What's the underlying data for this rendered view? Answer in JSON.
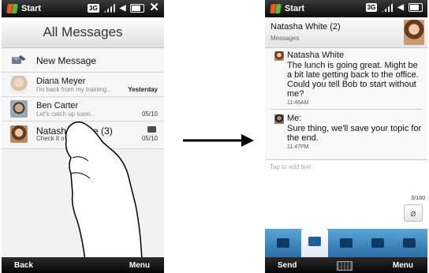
{
  "left_phone": {
    "status": {
      "start_label": "Start",
      "network": "3G",
      "close": "✕"
    },
    "header": {
      "title": "All Messages"
    },
    "new_message_label": "New Message",
    "messages": [
      {
        "name": "Diana Meyer",
        "preview": "I'm back from my training...",
        "date": "Yesterday"
      },
      {
        "name": "Ben Carter",
        "preview": "Let's catch up soon..",
        "date": "05/10"
      },
      {
        "name": "Natasha White (3)",
        "preview": "Check it o",
        "date": "05/10"
      }
    ],
    "softkeys": {
      "left": "Back",
      "right": "Menu"
    }
  },
  "right_phone": {
    "status": {
      "start_label": "Start",
      "network": "3G"
    },
    "conversation": {
      "title": "Natasha White (2)",
      "subtitle": "Messages"
    },
    "thread": [
      {
        "sender": "Natasha White",
        "text": "The lunch is going great. Might be a bit late getting back to the office. Could you tell Bob to start without me?",
        "time": "11:46AM"
      },
      {
        "sender": "Me:",
        "text": "Sure thing, we'll save your topic for the end.",
        "time": "11:47PM"
      }
    ],
    "compose": {
      "placeholder": "Tap to add text",
      "char_count": "0/160"
    },
    "softkeys": {
      "left": "Send",
      "right": "Menu"
    }
  },
  "colors": {
    "tabbar": "#2b6fa8",
    "status_bar": "#0c0c0c",
    "arrow": "#000000"
  },
  "icons": [
    "windows-flag-icon",
    "signal-icon",
    "speaker-icon",
    "battery-icon",
    "close-icon",
    "new-message-icon",
    "message-icon",
    "keyboard-icon",
    "attach-icon",
    "tap-finger-illustration"
  ]
}
